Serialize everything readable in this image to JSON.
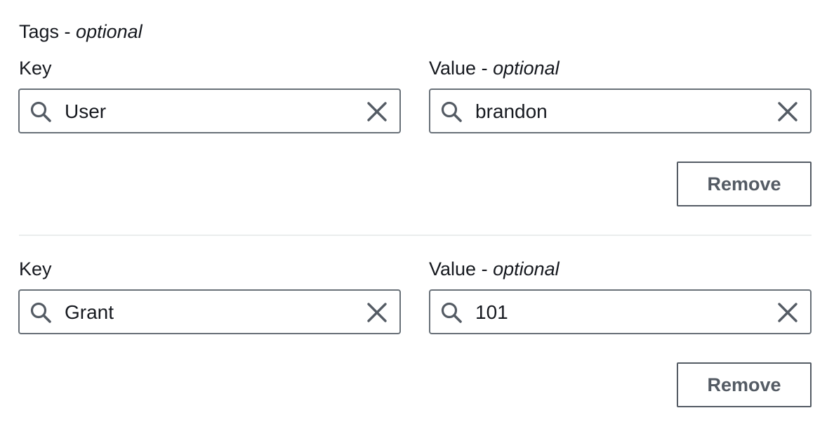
{
  "section": {
    "title": "Tags",
    "title_suffix": "optional",
    "separator": " - "
  },
  "tags": [
    {
      "key_label": "Key",
      "value_label": "Value",
      "value_label_suffix": "optional",
      "key": "User",
      "value": "brandon",
      "remove_label": "Remove"
    },
    {
      "key_label": "Key",
      "value_label": "Value",
      "value_label_suffix": "optional",
      "key": "Grant",
      "value": "101",
      "remove_label": "Remove"
    }
  ],
  "icons": {
    "search": "search-icon",
    "clear": "close-icon"
  },
  "colors": {
    "text": "#16191f",
    "border": "#687078",
    "button_text": "#545b64",
    "icon": "#545b64",
    "divider": "#eaeded"
  }
}
